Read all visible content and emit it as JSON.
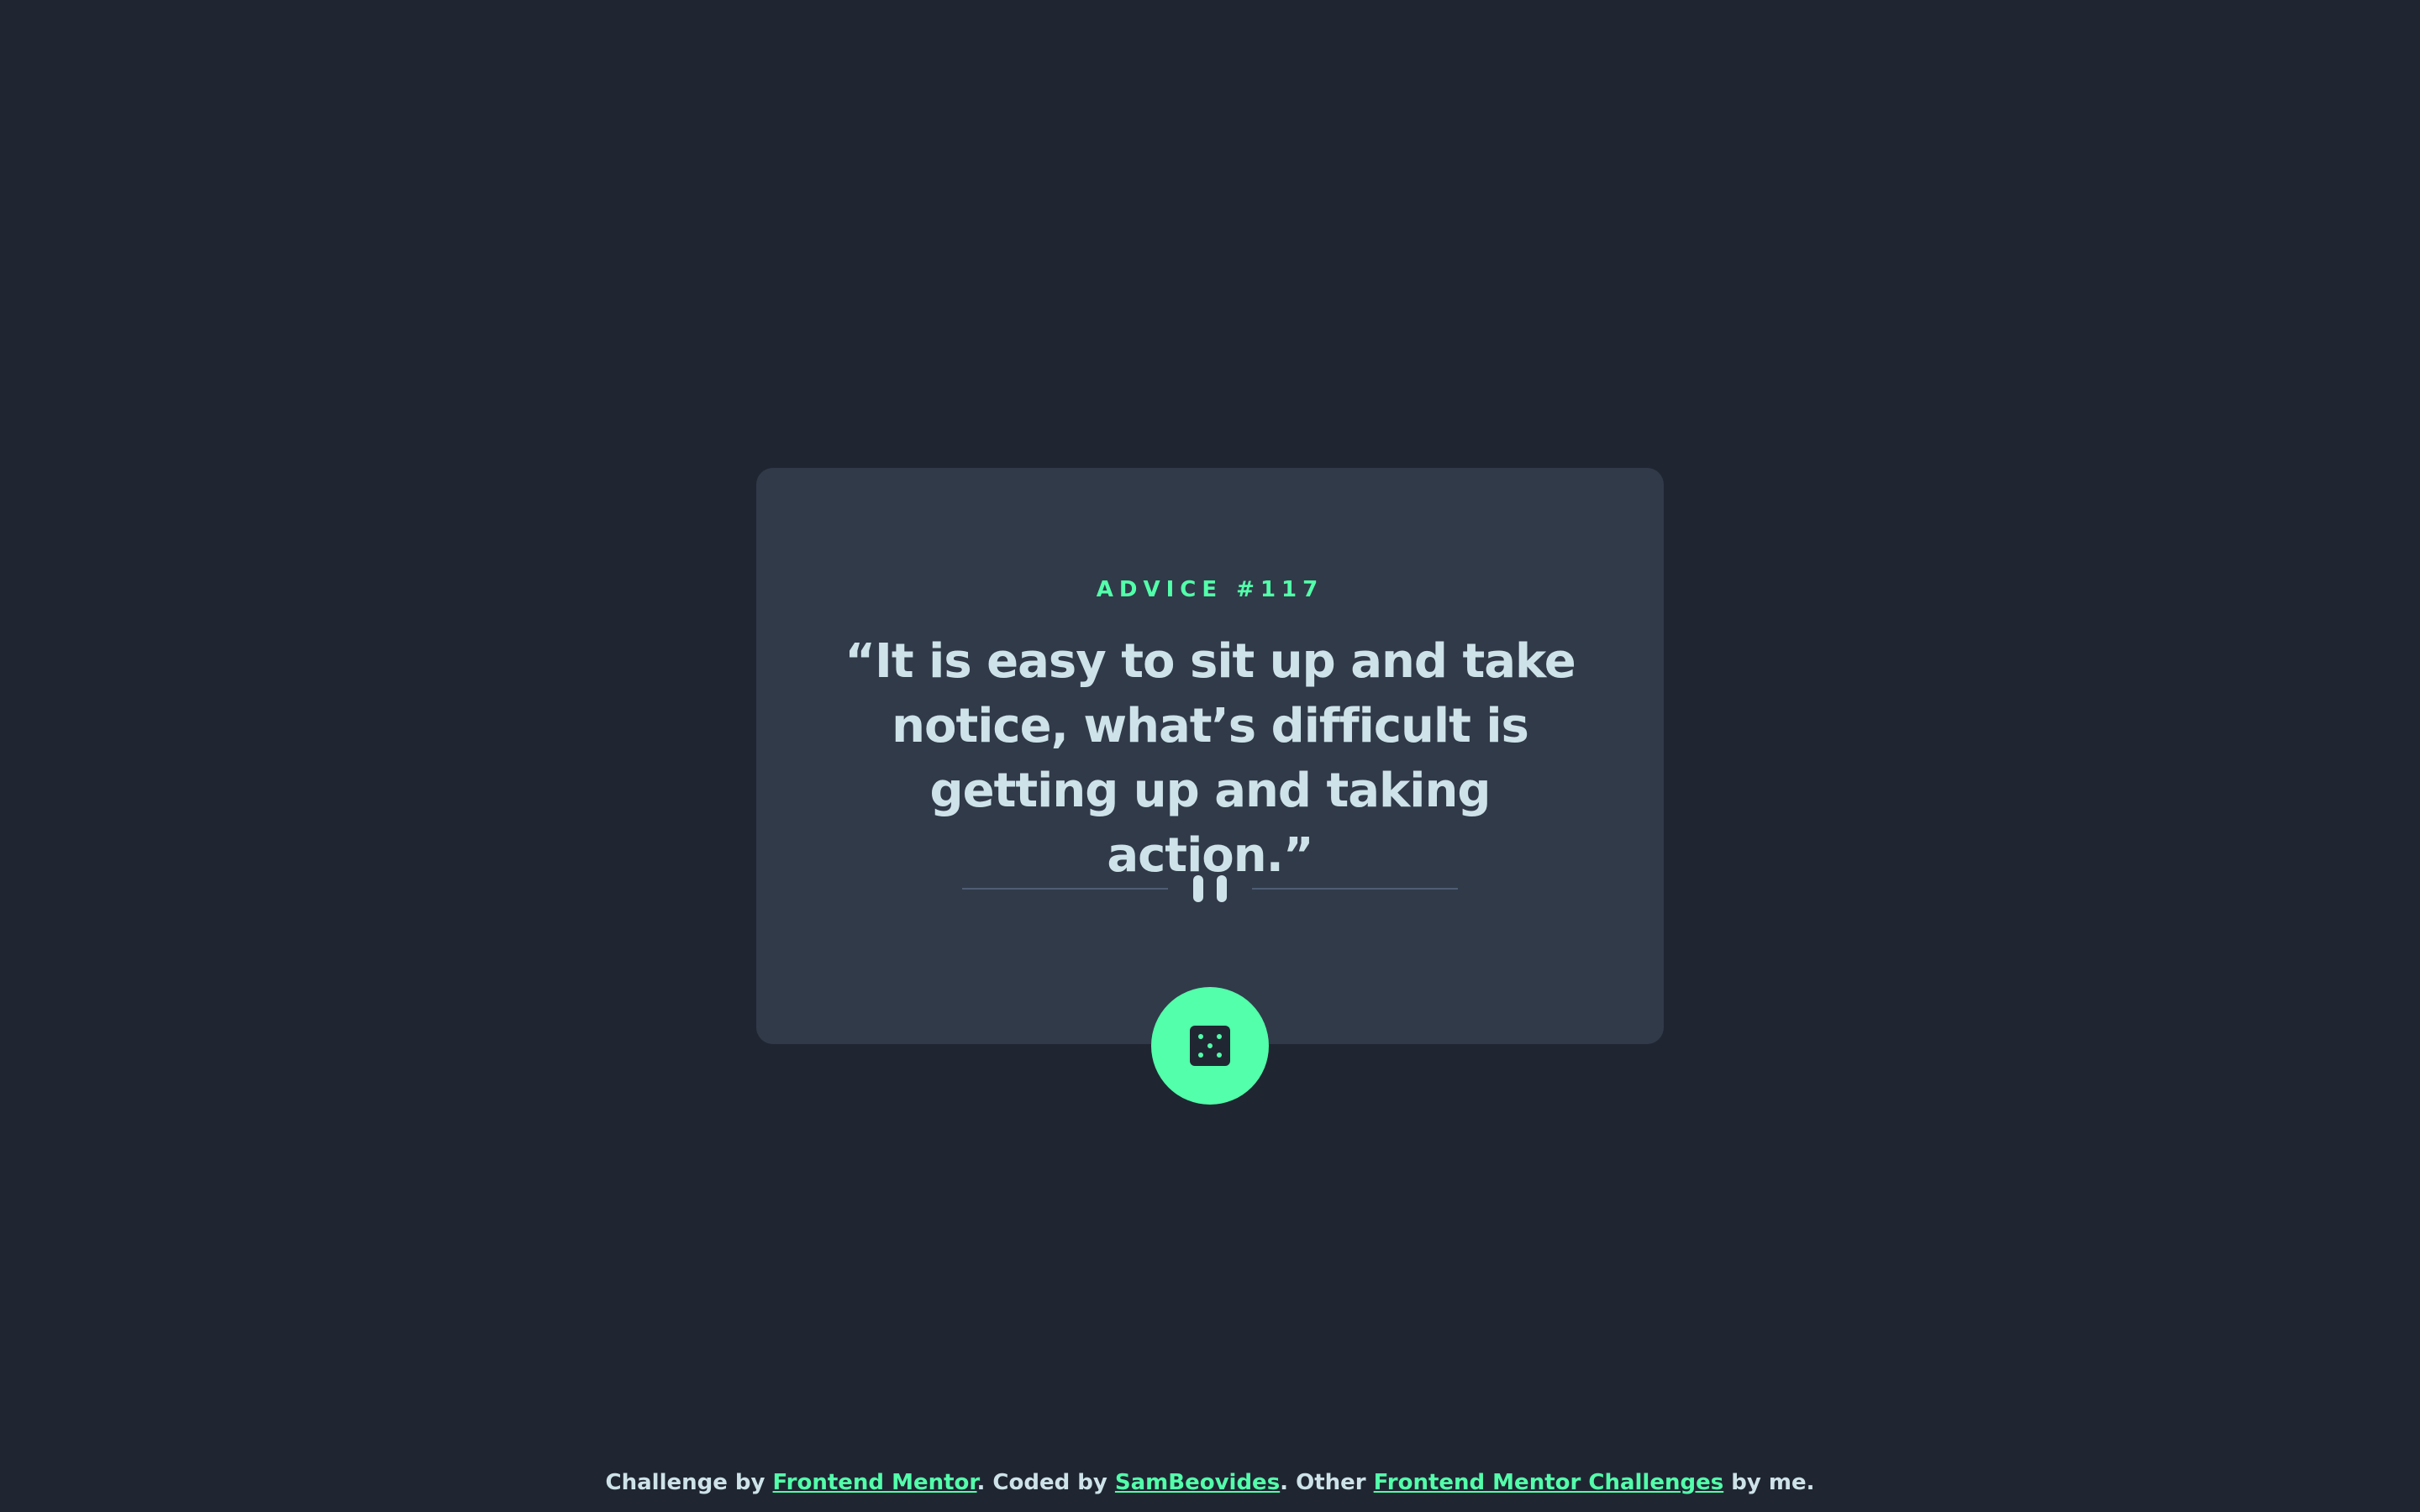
{
  "advice": {
    "id_label": "ADVICE #117",
    "quote": "“It is easy to sit up and take notice, what’s difficult is getting up and taking action.”"
  },
  "footer": {
    "prefix": "Challenge by ",
    "link_1": "Frontend Mentor",
    "middle_1": ". Coded by ",
    "link_2": "SamBeovides",
    "middle_2": ". Other ",
    "link_3": "Frontend Mentor Challenges",
    "suffix": " by me."
  },
  "icons": {
    "divider": "pause-divider-icon",
    "dice": "dice-icon"
  },
  "colors": {
    "background": "#1f2632",
    "card": "#313a49",
    "accent": "#53ffaa",
    "text": "#cee3e9",
    "divider_line": "#4f5d74"
  }
}
